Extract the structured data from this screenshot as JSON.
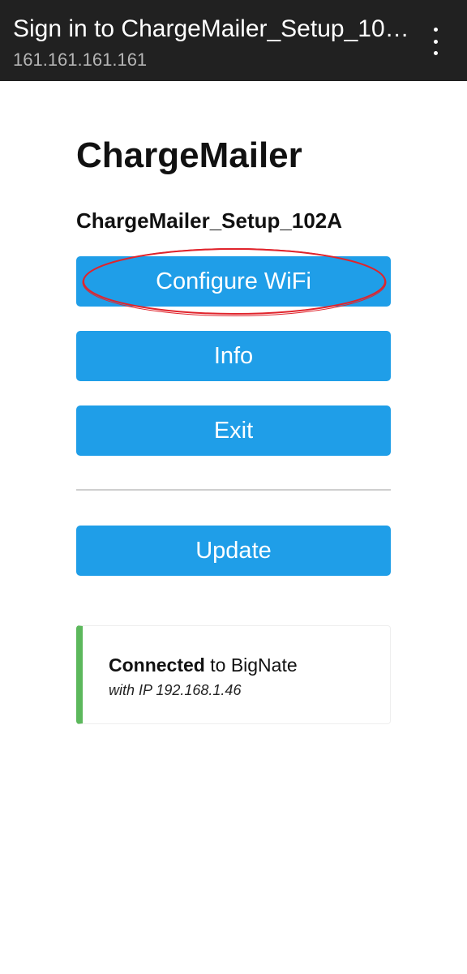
{
  "browser": {
    "title": "Sign in to ChargeMailer_Setup_10…",
    "url": "161.161.161.161",
    "menu_icon": "more-vert-icon"
  },
  "page": {
    "app_title": "ChargeMailer",
    "network_name": "ChargeMailer_Setup_102A"
  },
  "buttons": {
    "configure_wifi": "Configure WiFi",
    "info": "Info",
    "exit": "Exit",
    "update": "Update"
  },
  "status": {
    "state": "Connected",
    "connector": " to ",
    "ssid": "BigNate",
    "ip_line": "with IP 192.168.1.46",
    "accent_color": "#5cb85c"
  },
  "colors": {
    "button": "#1f9ee8",
    "annotation": "#e0242c",
    "topbar": "#212121"
  }
}
